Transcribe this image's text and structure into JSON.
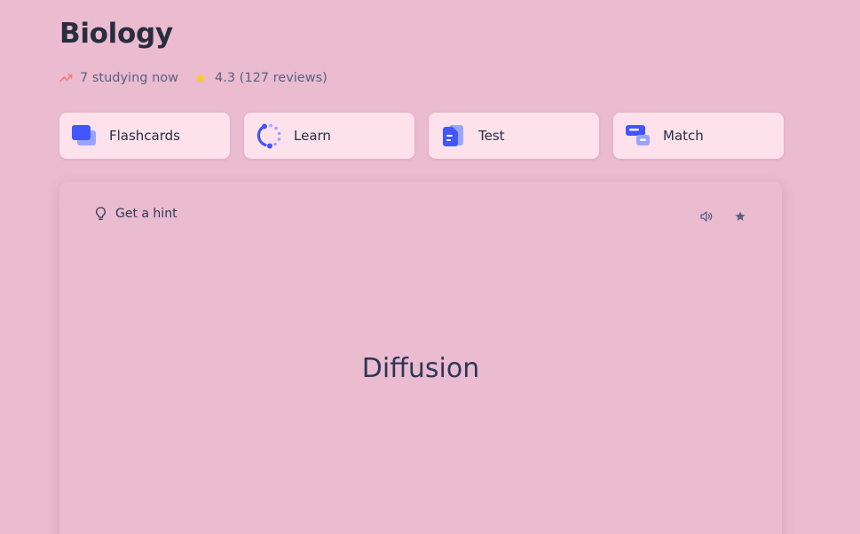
{
  "header": {
    "title": "Biology",
    "studying_now": "7 studying now",
    "rating": "4.3 (127 reviews)",
    "trend_icon": "trend-up-icon",
    "star_icon": "star-icon"
  },
  "modes": [
    {
      "label": "Flashcards",
      "icon": "flashcards-icon"
    },
    {
      "label": "Learn",
      "icon": "learn-icon"
    },
    {
      "label": "Test",
      "icon": "test-icon"
    },
    {
      "label": "Match",
      "icon": "match-icon"
    }
  ],
  "card": {
    "hint_label": "Get a hint",
    "term": "Diffusion",
    "hint_icon": "lightbulb-icon",
    "audio_icon": "speaker-icon",
    "favorite_icon": "star-icon"
  },
  "colors": {
    "background": "#ebbbd0",
    "mode_tile": "#fde2ec",
    "accent_blue": "#4255ff",
    "rating_star": "#ffcd1f",
    "trend": "#ff7873"
  }
}
